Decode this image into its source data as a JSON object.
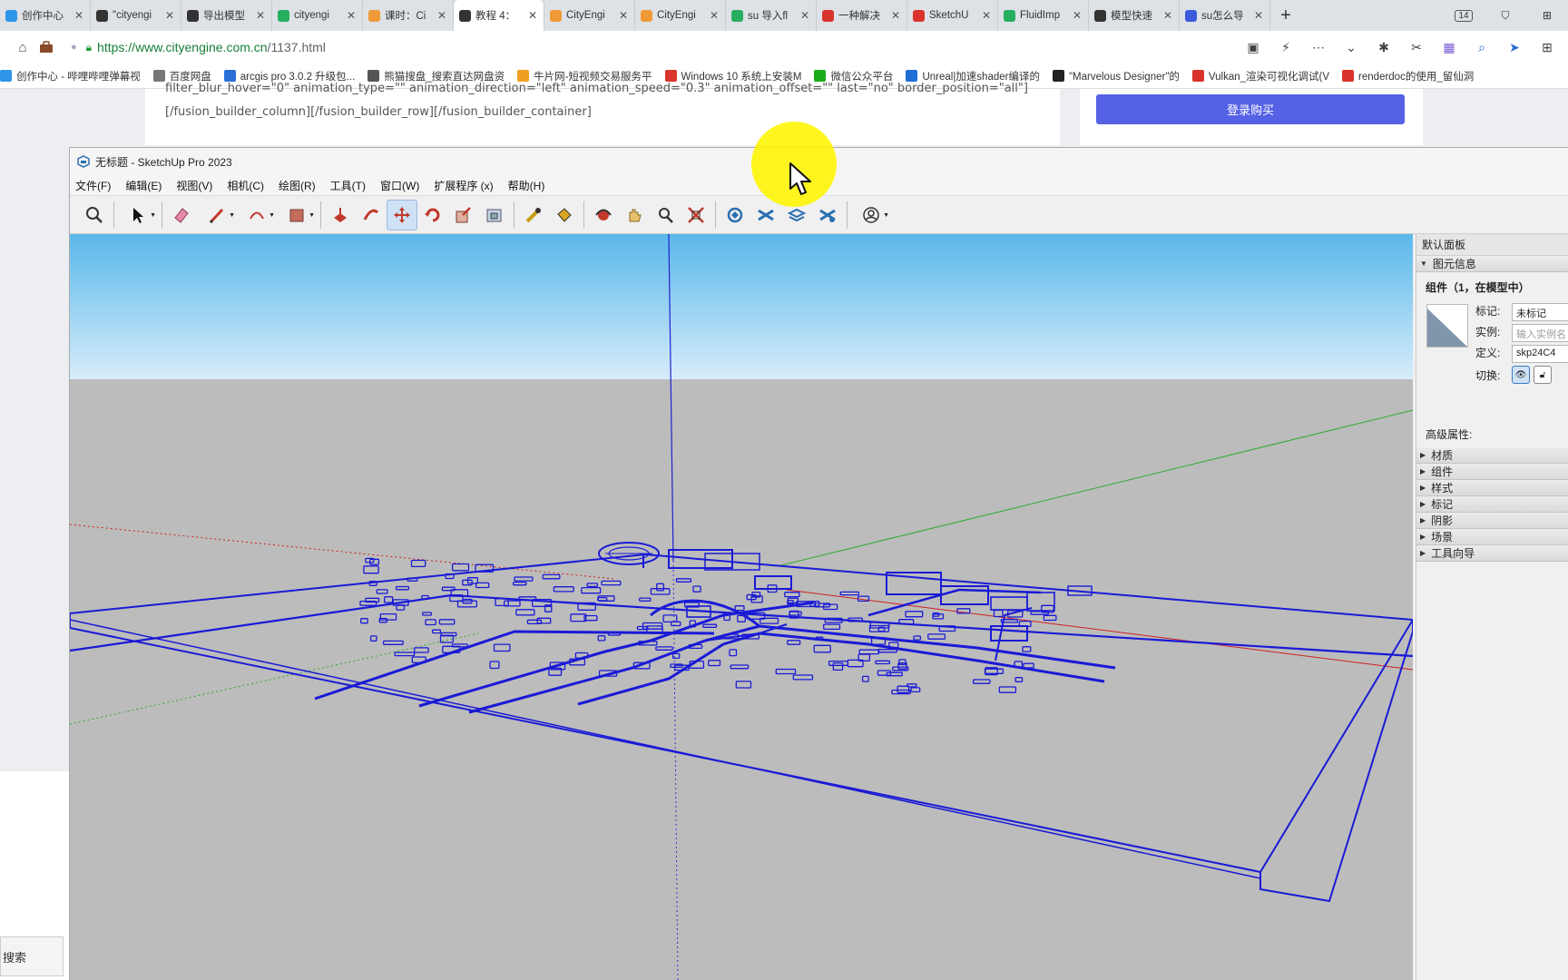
{
  "browser": {
    "tabs": [
      {
        "label": "创作中心",
        "color": "#2f95e8"
      },
      {
        "label": "\"cityengi",
        "color": "#333333"
      },
      {
        "label": "导出模型",
        "color": "#333333"
      },
      {
        "label": "cityengi",
        "color": "#27ae60"
      },
      {
        "label": "课时：Ci",
        "color": "#f09a37"
      },
      {
        "label": "教程 4：",
        "color": "#333333",
        "active": true
      },
      {
        "label": "CityEngi",
        "color": "#f09a37"
      },
      {
        "label": "CityEngi",
        "color": "#f09a37"
      },
      {
        "label": "su 导入fl",
        "color": "#27ae60"
      },
      {
        "label": "一种解决",
        "color": "#d9342b"
      },
      {
        "label": "SketchU",
        "color": "#d9342b"
      },
      {
        "label": "FluidImp",
        "color": "#27ae60"
      },
      {
        "label": "模型快速",
        "color": "#333333"
      },
      {
        "label": "su怎么导",
        "color": "#3b5bdb"
      }
    ],
    "tab_count": "14",
    "url_host": "https://www.cityengine.com.cn",
    "url_path": "/1137.html",
    "bookmarks": [
      {
        "label": "创作中心 - 哔哩哔哩弹幕视",
        "color": "#2f95e8"
      },
      {
        "label": "百度网盘",
        "color": "#777777"
      },
      {
        "label": "arcgis pro 3.0.2 升级包...",
        "color": "#2a6fd6"
      },
      {
        "label": "熊猫搜盘_搜索直达网盘资",
        "color": "#555555"
      },
      {
        "label": "牛片网-短视频交易服务平",
        "color": "#f0a020"
      },
      {
        "label": "Windows 10 系统上安装M",
        "color": "#d9342b"
      },
      {
        "label": "微信公众平台",
        "color": "#1aad19"
      },
      {
        "label": "Unreal|加速shader编译的",
        "color": "#1f6fd6"
      },
      {
        "label": "\"Marvelous Designer\"的",
        "color": "#222222"
      },
      {
        "label": "Vulkan_渲染可视化调试(V",
        "color": "#d9342b"
      },
      {
        "label": "renderdoc的使用_留仙洞",
        "color": "#d9342b"
      }
    ]
  },
  "webpage": {
    "article_lines": [
      "filter_blur_hover=\"0\" animation_type=\"\" animation_direction=\"left\" animation_speed=\"0.3\" animation_offset=\"\" last=\"no\" border_position=\"all\"]",
      "[/fusion_builder_column][/fusion_builder_row][/fusion_builder_container]"
    ],
    "buy_button": "登录购买",
    "search_label": "搜索"
  },
  "sketchup": {
    "title": "无标题 - SketchUp Pro 2023",
    "menus": [
      "文件(F)",
      "编辑(E)",
      "视图(V)",
      "相机(C)",
      "绘图(R)",
      "工具(T)",
      "窗口(W)",
      "扩展程序 (x)",
      "帮助(H)"
    ],
    "toolbar": [
      "zoom-icon",
      "sep",
      "select-icon",
      "sep",
      "eraser-icon",
      "pencil-icon",
      "arc-icon",
      "rectangle-icon",
      "sep",
      "push-pull-icon",
      "follow-me-icon",
      "move-icon",
      "rotate-icon",
      "scale-icon",
      "offset-icon",
      "sep",
      "tape-measure-icon",
      "paint-bucket-icon",
      "sep",
      "orbit-icon",
      "pan-icon",
      "zoom-window-icon",
      "zoom-extents-icon",
      "sep",
      "warehouse-icon",
      "extension-icon",
      "layers-icon",
      "extension-manager-icon",
      "sep",
      "account-icon"
    ],
    "tray": {
      "title": "默认面板",
      "entity_info_header": "图元信息",
      "entity_heading": "组件（1，在模型中）",
      "tag_label": "标记:",
      "tag_value": "未标记",
      "instance_label": "实例:",
      "instance_placeholder": "输入实例名",
      "definition_label": "定义:",
      "definition_value": "skp24C4",
      "toggle_label": "切换:",
      "advanced_label": "高级属性:",
      "sections": [
        "材质",
        "组件",
        "样式",
        "标记",
        "阴影",
        "场景",
        "工具向导"
      ]
    }
  },
  "colors": {
    "model_lines": "#1a1ad6",
    "sky_top": "#5ab7ea",
    "sky_bottom": "#d6edfa",
    "ground": "#bcbcbc",
    "buy_button": "#5662e6"
  }
}
